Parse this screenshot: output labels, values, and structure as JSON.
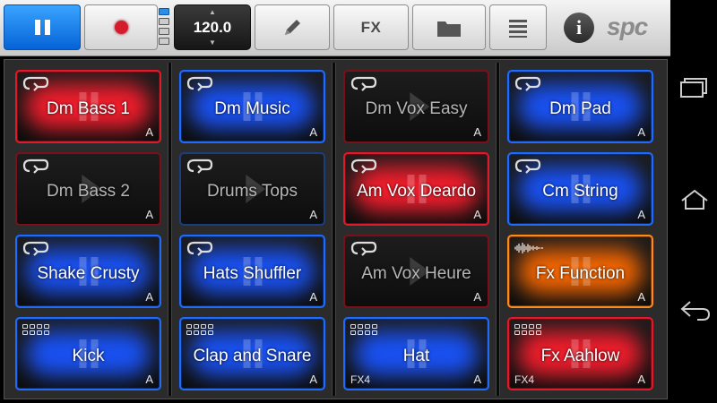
{
  "toolbar": {
    "play_state": "pause",
    "bpm": "120.0",
    "fx_label": "FX",
    "brand": "spc",
    "info_label": "i"
  },
  "pads": [
    [
      {
        "label": "Dm Bass 1",
        "tag": "A",
        "fx": "",
        "color": "red",
        "state": "playing",
        "icon": "loop"
      },
      {
        "label": "Dm Music",
        "tag": "A",
        "fx": "",
        "color": "blue",
        "state": "playing",
        "icon": "loop"
      },
      {
        "label": "Dm Vox Easy",
        "tag": "A",
        "fx": "",
        "color": "dimred",
        "state": "stopped",
        "icon": "loop"
      },
      {
        "label": "Dm Pad",
        "tag": "A",
        "fx": "",
        "color": "blue",
        "state": "playing",
        "icon": "loop"
      }
    ],
    [
      {
        "label": "Dm Bass 2",
        "tag": "A",
        "fx": "",
        "color": "dimred",
        "state": "stopped",
        "icon": "loop"
      },
      {
        "label": "Drums Tops",
        "tag": "A",
        "fx": "",
        "color": "dimblue",
        "state": "stopped",
        "icon": "loop"
      },
      {
        "label": "Am Vox Deardo",
        "tag": "A",
        "fx": "",
        "color": "red",
        "state": "playing",
        "icon": "loop"
      },
      {
        "label": "Cm String",
        "tag": "A",
        "fx": "",
        "color": "blue",
        "state": "playing",
        "icon": "loop"
      }
    ],
    [
      {
        "label": "Shake Crusty",
        "tag": "A",
        "fx": "",
        "color": "blue",
        "state": "playing",
        "icon": "loop"
      },
      {
        "label": "Hats Shuffler",
        "tag": "A",
        "fx": "",
        "color": "blue",
        "state": "playing",
        "icon": "loop"
      },
      {
        "label": "Am Vox Heure",
        "tag": "A",
        "fx": "",
        "color": "dimred",
        "state": "stopped",
        "icon": "loop"
      },
      {
        "label": "Fx Function",
        "tag": "A",
        "fx": "",
        "color": "orange",
        "state": "playing",
        "icon": "wave"
      }
    ],
    [
      {
        "label": "Kick",
        "tag": "A",
        "fx": "",
        "color": "blue",
        "state": "playing",
        "icon": "grid"
      },
      {
        "label": "Clap and Snare",
        "tag": "A",
        "fx": "",
        "color": "blue",
        "state": "playing",
        "icon": "grid"
      },
      {
        "label": "Hat",
        "tag": "A",
        "fx": "FX4",
        "color": "blue",
        "state": "playing",
        "icon": "grid"
      },
      {
        "label": "Fx Aahlow",
        "tag": "A",
        "fx": "FX4",
        "color": "red",
        "state": "playing",
        "icon": "grid"
      }
    ]
  ],
  "icons": {
    "pause": "pause-icon",
    "record": "record-icon",
    "edit": "pencil-icon",
    "folder": "folder-icon",
    "list": "list-icon",
    "info": "info-icon",
    "recent_apps": "recent-apps-icon",
    "home": "home-icon",
    "back": "back-icon"
  },
  "colors": {
    "red": "#ff1e2e",
    "blue": "#1a55ff",
    "orange": "#ff6a00",
    "play_button": "#0a7cf0"
  }
}
